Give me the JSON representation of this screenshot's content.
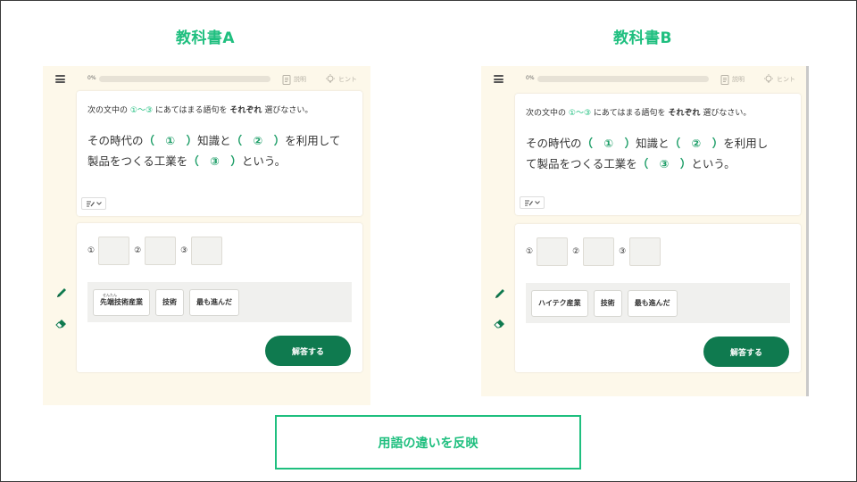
{
  "labels": {
    "a": "教科書A",
    "b": "教科書B"
  },
  "caption": "用語の違いを反映",
  "colors": {
    "accent": "#1fbf7f",
    "button": "#0f7a4f",
    "panel_bg": "#fdf8ea"
  },
  "panel_a": {
    "progress_text": "0%",
    "progress_value": 0,
    "explain_label": "説明",
    "hint_label": "ヒント",
    "instruction": {
      "pre": "次の文中の",
      "range": "①～③",
      "mid": "にあてはまる語句を",
      "bold": "それぞれ",
      "post": "選びなさい。"
    },
    "sentence": {
      "p1": "その時代の",
      "b1": "（　①　）",
      "p2": "知識と",
      "b2": "（　②　）",
      "p3": "を利用して",
      "p4": "製品をつくる工業を",
      "b3": "（　③　）",
      "p5": "という。"
    },
    "slots": [
      "①",
      "②",
      "③"
    ],
    "choices": [
      {
        "label": "先端技術産業",
        "ruby": "せんたん"
      },
      {
        "label": "技術",
        "ruby": ""
      },
      {
        "label": "最も進んだ",
        "ruby": ""
      }
    ],
    "submit_label": "解答する"
  },
  "panel_b": {
    "progress_text": "0%",
    "progress_value": 0,
    "explain_label": "説明",
    "hint_label": "ヒント",
    "instruction": {
      "pre": "次の文中の",
      "range": "①～③",
      "mid": "にあてはまる語句を",
      "bold": "それぞれ",
      "post": "選びなさい。"
    },
    "sentence": {
      "p1": "その時代の",
      "b1": "（　①　）",
      "p2": "知識と",
      "b2": "（　②　）",
      "p3": "を利用し",
      "p4": "て製品をつくる工業を",
      "b3": "（　③　）",
      "p5": "という。"
    },
    "slots": [
      "①",
      "②",
      "③"
    ],
    "choices": [
      {
        "label": "ハイテク産業",
        "ruby": ""
      },
      {
        "label": "技術",
        "ruby": ""
      },
      {
        "label": "最も進んだ",
        "ruby": ""
      }
    ],
    "submit_label": "解答する"
  }
}
